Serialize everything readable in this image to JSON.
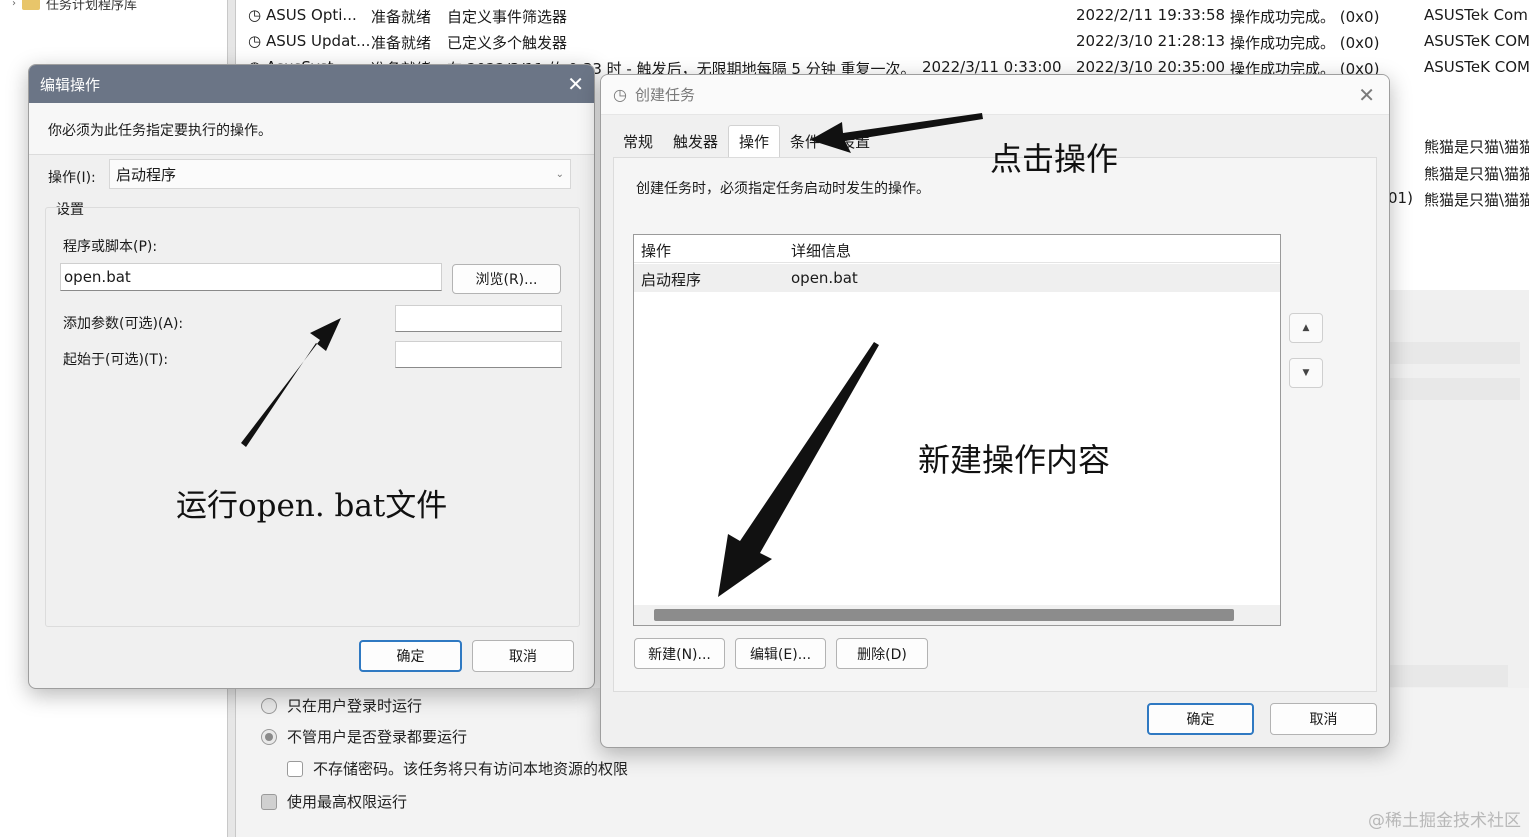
{
  "background_window": {
    "tree_item_label": "任务计划程序库",
    "tasks": [
      {
        "name": "ASUS Opti...",
        "status": "准备就绪",
        "trigger": "自定义事件筛选器",
        "next_run": "",
        "last_run": "2022/2/11 19:33:58",
        "result": "操作成功完成。 (0x0)",
        "author": "ASUSTek Comp"
      },
      {
        "name": "ASUS Updat...",
        "status": "准备就绪",
        "trigger": "已定义多个触发器",
        "next_run": "",
        "last_run": "2022/3/10 21:28:13",
        "result": "操作成功完成。 (0x0)",
        "author": "ASUSTeK COM"
      },
      {
        "name": "AsusSyst...",
        "status": "准备就绪",
        "trigger": "在 2022/3/11 的 0:33 时 - 触发后，无限期地每隔 5 分钟 重复一次。",
        "next_run": "2022/3/11 0:33:00",
        "last_run": "2022/3/10 20:35:00",
        "result": "操作成功完成。 (0x0)",
        "author": "ASUSTeK COM"
      }
    ],
    "side_users": [
      "熊猫是只猫\\猫猫",
      "熊猫是只猫\\猫猫",
      "熊猫是只猫\\猫猫"
    ],
    "side_partial_result": "01)",
    "options": {
      "run_when_logged_on": "只在用户登录时运行",
      "run_whether_logged_on": "不管用户是否登录都要运行",
      "do_not_store_password": "不存储密码。该任务将只有访问本地资源的权限",
      "run_highest_privileges": "使用最高权限运行"
    }
  },
  "edit_dialog": {
    "title": "编辑操作",
    "instruction": "你必须为此任务指定要执行的操作。",
    "action_label": "操作(I):",
    "action_value": "启动程序",
    "settings_label": "设置",
    "program_label": "程序或脚本(P):",
    "program_value": "open.bat",
    "browse_button": "浏览(R)...",
    "args_label": "添加参数(可选)(A):",
    "args_value": "",
    "start_in_label": "起始于(可选)(T):",
    "start_in_value": "",
    "ok_button": "确定",
    "cancel_button": "取消"
  },
  "create_dialog": {
    "title": "创建任务",
    "tabs": [
      "常规",
      "触发器",
      "操作",
      "条件",
      "设置"
    ],
    "active_tab": "操作",
    "instruction": "创建任务时，必须指定任务启动时发生的操作。",
    "table_headers": [
      "操作",
      "详细信息"
    ],
    "table_rows": [
      {
        "action": "启动程序",
        "details": "open.bat"
      }
    ],
    "new_button": "新建(N)...",
    "edit_button": "编辑(E)...",
    "delete_button": "删除(D)",
    "ok_button": "确定",
    "cancel_button": "取消"
  },
  "annotations": {
    "click_action": "点击操作",
    "new_action_content": "新建操作内容",
    "run_file": "运行open. bat文件"
  },
  "watermark": "@稀土掘金技术社区",
  "colors": {
    "edit_titlebar": "#6b7586",
    "primary_button_border": "#2f79c2"
  }
}
